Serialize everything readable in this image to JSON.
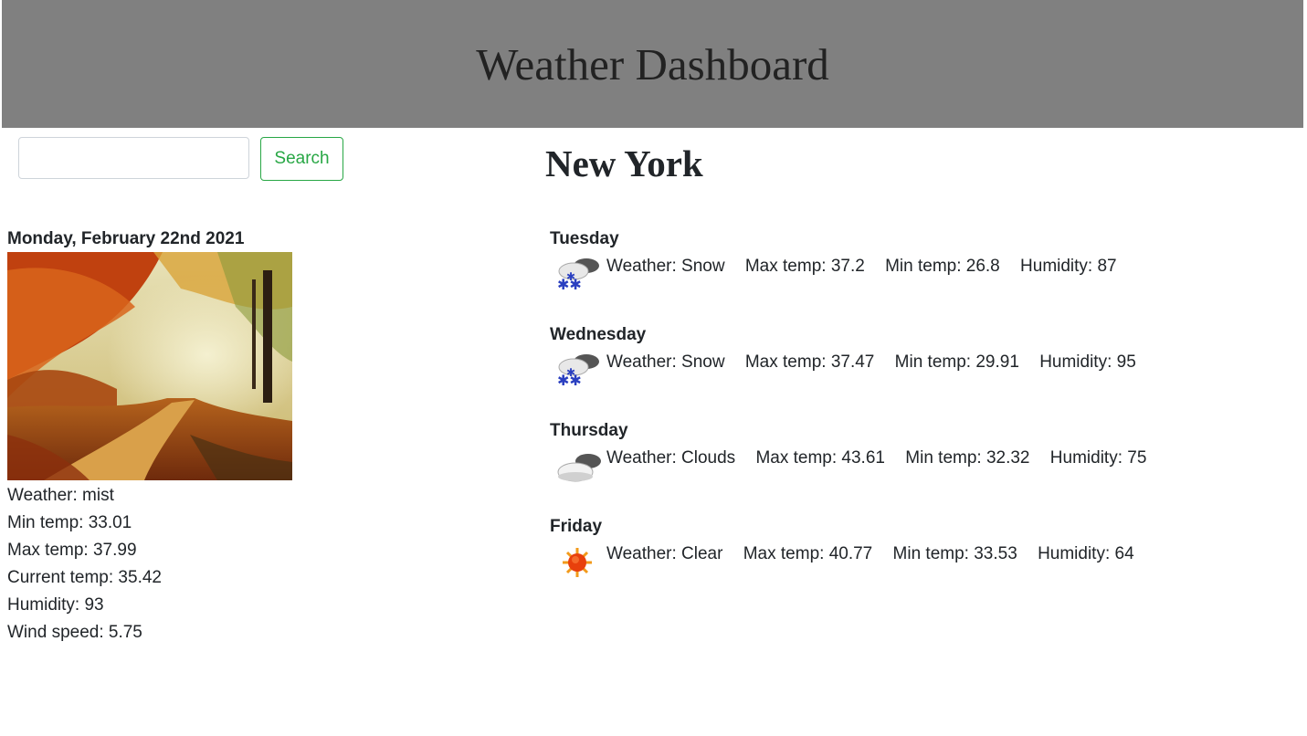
{
  "header": {
    "title": "Weather Dashboard"
  },
  "search": {
    "placeholder": "",
    "value": "",
    "button_label": "Search"
  },
  "city": "New York",
  "today": {
    "date": "Monday, February 22nd 2021",
    "weather": "Weather: mist",
    "min_temp": "Min temp: 33.01",
    "max_temp": "Max temp: 37.99",
    "current_temp": "Current temp: 35.42",
    "humidity": "Humidity: 93",
    "wind_speed": "Wind speed: 5.75"
  },
  "forecast": [
    {
      "day": "Tuesday",
      "icon": "snow-icon",
      "weather": "Weather: Snow",
      "max": "Max temp: 37.2",
      "min": "Min temp: 26.8",
      "humidity": "Humidity: 87"
    },
    {
      "day": "Wednesday",
      "icon": "snow-icon",
      "weather": "Weather: Snow",
      "max": "Max temp: 37.47",
      "min": "Min temp: 29.91",
      "humidity": "Humidity: 95"
    },
    {
      "day": "Thursday",
      "icon": "clouds-icon",
      "weather": "Weather: Clouds",
      "max": "Max temp: 43.61",
      "min": "Min temp: 32.32",
      "humidity": "Humidity: 75"
    },
    {
      "day": "Friday",
      "icon": "sun-icon",
      "weather": "Weather: Clear",
      "max": "Max temp: 40.77",
      "min": "Min temp: 33.53",
      "humidity": "Humidity: 64"
    }
  ],
  "colors": {
    "header_bg": "#808080",
    "button_accent": "#28a745"
  }
}
